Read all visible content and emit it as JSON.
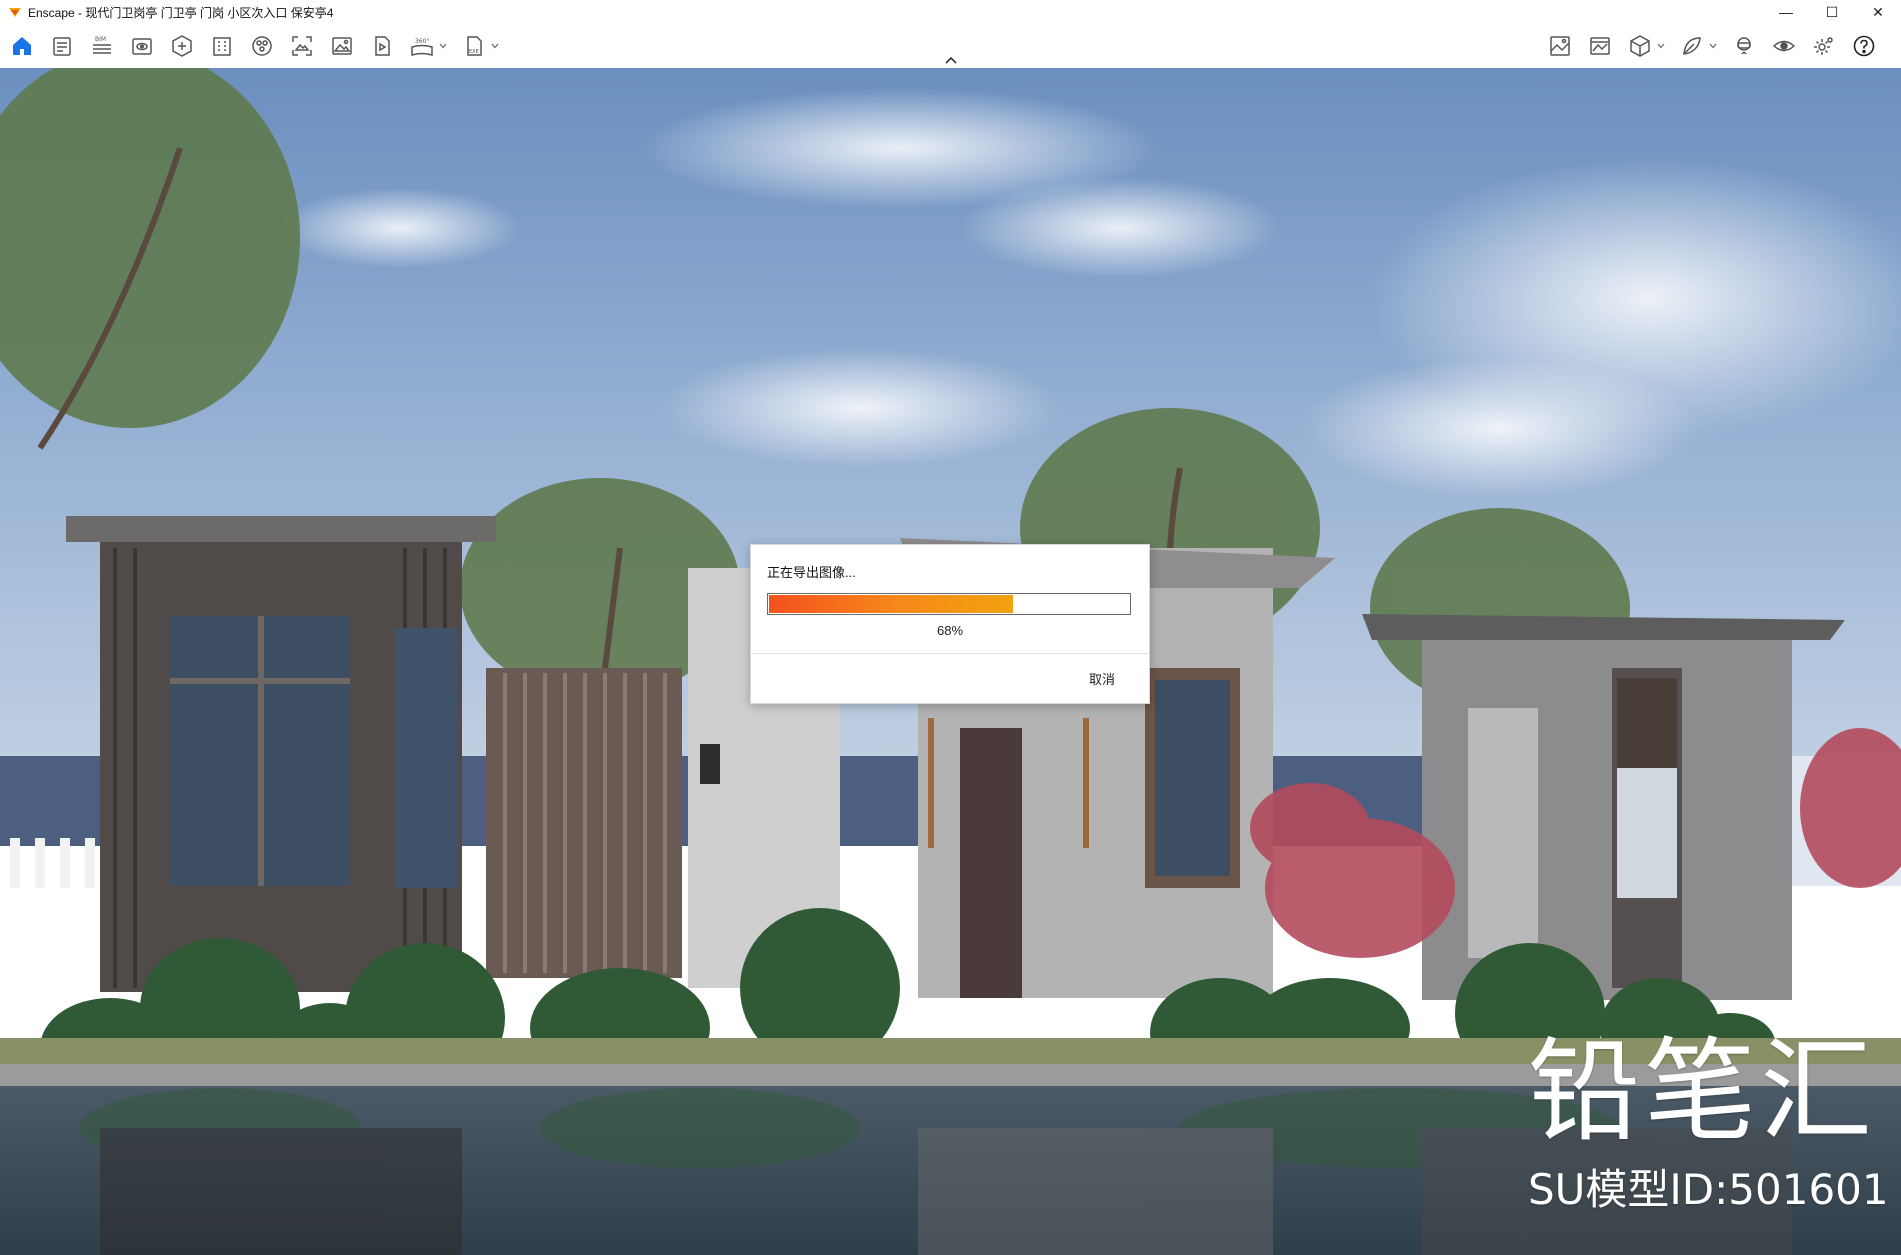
{
  "window": {
    "title": "Enscape - 现代门卫岗亭 门卫亭 门岗 小区次入口 保安亭4",
    "controls": {
      "minimize": "—",
      "maximize": "☐",
      "close": "✕"
    }
  },
  "toolbar": {
    "left_icons": [
      "home-icon",
      "settings-sheet-icon",
      "bim-icon",
      "view-icon",
      "asset-library-icon",
      "building-icon",
      "materials-icon",
      "capture-icon",
      "image-icon",
      "batch-render-icon",
      "panorama-icon",
      "exe-export-icon"
    ],
    "bim_label": "BIM",
    "panorama_label": "360°",
    "exe_label": "EXE",
    "right_icons": [
      "map-icon",
      "image-settings-icon",
      "cube-view-icon",
      "feather-icon",
      "vr-headset-icon",
      "live-view-icon",
      "gear-icon",
      "help-icon"
    ]
  },
  "dialog": {
    "title": "正在导出图像...",
    "progress": 0.68,
    "progress_text": "68%",
    "cancel": "取消"
  },
  "watermark": {
    "brand": "铅笔汇",
    "model_id": "SU模型ID:501601"
  },
  "colors": {
    "accent_blue": "#1a73e8",
    "progress_start": "#f4511e",
    "progress_end": "#f2a20e"
  }
}
